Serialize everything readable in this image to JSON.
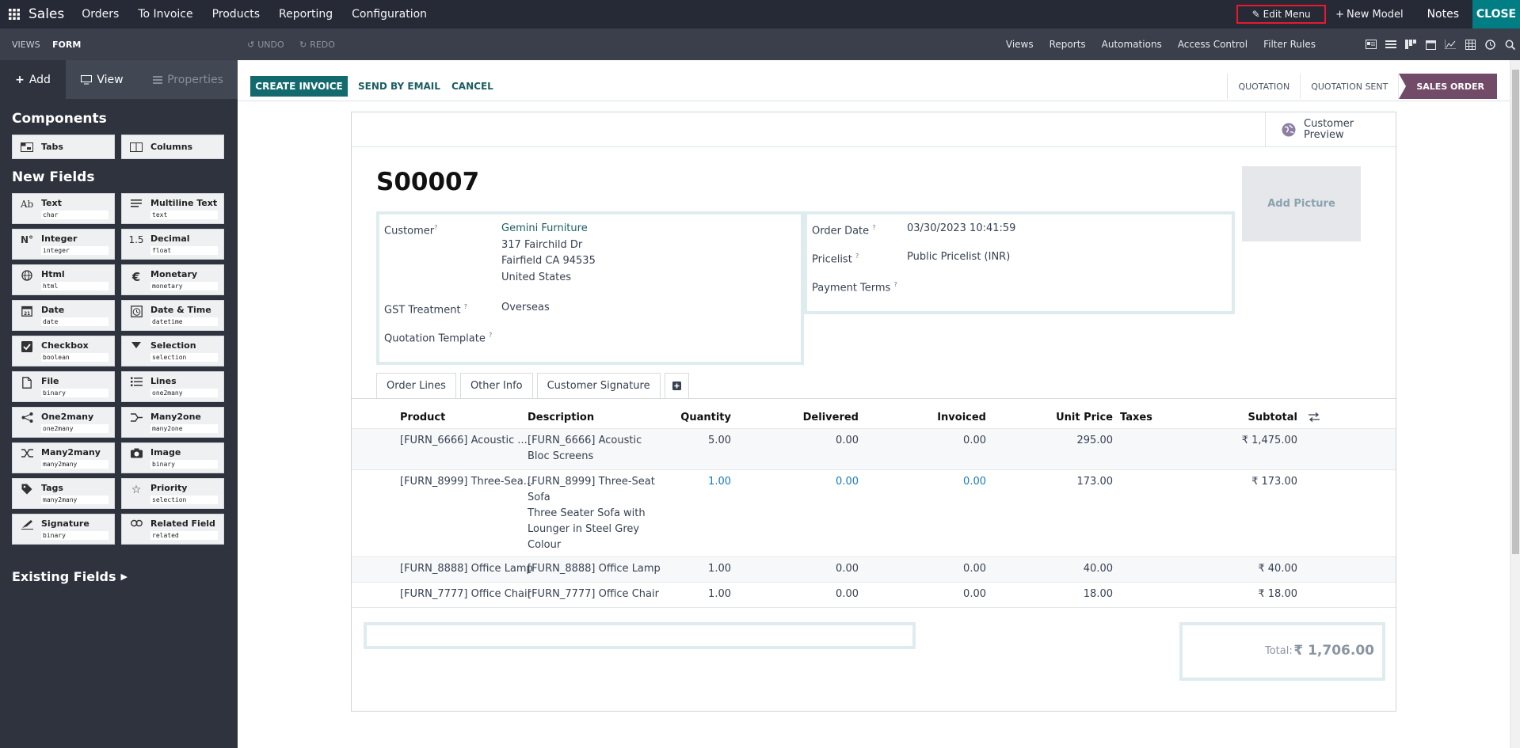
{
  "topbar": {
    "app_name": "Sales",
    "menu": [
      "Orders",
      "To Invoice",
      "Products",
      "Reporting",
      "Configuration"
    ],
    "edit_menu": "Edit Menu",
    "new_model": "New Model",
    "notes": "Notes",
    "close": "CLOSE"
  },
  "subbar": {
    "views": "VIEWS",
    "form": "FORM",
    "undo": "UNDO",
    "redo": "REDO",
    "links": [
      "Views",
      "Reports",
      "Automations",
      "Access Control",
      "Filter Rules"
    ]
  },
  "sidebar": {
    "tabs": {
      "add": "Add",
      "view": "View",
      "properties": "Properties"
    },
    "components_heading": "Components",
    "components": [
      {
        "name": "Tabs",
        "icon": "tabs-icon"
      },
      {
        "name": "Columns",
        "icon": "columns-icon"
      }
    ],
    "new_fields_heading": "New Fields",
    "fields": [
      {
        "name": "Text",
        "type": "char",
        "icon": "Ab"
      },
      {
        "name": "Multiline Text",
        "type": "text",
        "icon": "lines-icon"
      },
      {
        "name": "Integer",
        "type": "integer",
        "icon": "N°"
      },
      {
        "name": "Decimal",
        "type": "float",
        "icon": "1.5"
      },
      {
        "name": "Html",
        "type": "html",
        "icon": "globe-icon"
      },
      {
        "name": "Monetary",
        "type": "monetary",
        "icon": "€"
      },
      {
        "name": "Date",
        "type": "date",
        "icon": "calendar-icon"
      },
      {
        "name": "Date & Time",
        "type": "datetime",
        "icon": "clock-icon"
      },
      {
        "name": "Checkbox",
        "type": "boolean",
        "icon": "checkbox-icon"
      },
      {
        "name": "Selection",
        "type": "selection",
        "icon": "caret-down-icon"
      },
      {
        "name": "File",
        "type": "binary",
        "icon": "file-icon"
      },
      {
        "name": "Lines",
        "type": "one2many",
        "icon": "list-icon"
      },
      {
        "name": "One2many",
        "type": "one2many",
        "icon": "share-icon"
      },
      {
        "name": "Many2one",
        "type": "many2one",
        "icon": "merge-icon"
      },
      {
        "name": "Many2many",
        "type": "many2many",
        "icon": "shuffle-icon"
      },
      {
        "name": "Image",
        "type": "binary",
        "icon": "camera-icon"
      },
      {
        "name": "Tags",
        "type": "many2many",
        "icon": "tag-icon"
      },
      {
        "name": "Priority",
        "type": "selection",
        "icon": "star-icon"
      },
      {
        "name": "Signature",
        "type": "binary",
        "icon": "signature-icon"
      },
      {
        "name": "Related Field",
        "type": "related",
        "icon": "link-icon"
      }
    ],
    "existing_fields": "Existing Fields"
  },
  "control": {
    "create_invoice": "CREATE INVOICE",
    "send_by_email": "SEND BY EMAIL",
    "cancel": "CANCEL",
    "stages": [
      "QUOTATION",
      "QUOTATION SENT",
      "SALES ORDER"
    ],
    "active_stage": "SALES ORDER"
  },
  "form": {
    "customer_preview": [
      "Customer",
      "Preview"
    ],
    "name": "S00007",
    "add_picture": "Add Picture",
    "labels": {
      "customer": "Customer",
      "gst": "GST Treatment",
      "quotation_template": "Quotation Template",
      "order_date": "Order Date",
      "pricelist": "Pricelist",
      "payment_terms": "Payment Terms"
    },
    "values": {
      "customer_name": "Gemini Furniture",
      "address1": "317 Fairchild Dr",
      "address2": "Fairfield CA 94535",
      "address3": "United States",
      "gst": "Overseas",
      "order_date": "03/30/2023 10:41:59",
      "pricelist": "Public Pricelist (INR)"
    },
    "tabs": [
      "Order Lines",
      "Other Info",
      "Customer Signature"
    ],
    "table_headers": {
      "product": "Product",
      "description": "Description",
      "quantity": "Quantity",
      "delivered": "Delivered",
      "invoiced": "Invoiced",
      "unit_price": "Unit Price",
      "taxes": "Taxes",
      "subtotal": "Subtotal"
    },
    "lines": [
      {
        "product": "[FURN_6666] Acoustic ...",
        "description": [
          "[FURN_6666] Acoustic",
          "Bloc Screens"
        ],
        "quantity": "5.00",
        "delivered": "0.00",
        "invoiced": "0.00",
        "unit_price": "295.00",
        "subtotal": "₹ 1,475.00"
      },
      {
        "product": "[FURN_8999] Three-Sea...",
        "description": [
          "[FURN_8999] Three-Seat",
          "Sofa",
          "Three Seater Sofa with",
          "Lounger in Steel Grey",
          "Colour"
        ],
        "quantity": "1.00",
        "delivered": "0.00",
        "invoiced": "0.00",
        "unit_price": "173.00",
        "subtotal": "₹ 173.00"
      },
      {
        "product": "[FURN_8888] Office Lamp",
        "description": [
          "[FURN_8888] Office Lamp"
        ],
        "quantity": "1.00",
        "delivered": "0.00",
        "invoiced": "0.00",
        "unit_price": "40.00",
        "subtotal": "₹ 40.00"
      },
      {
        "product": "[FURN_7777] Office Chair",
        "description": [
          "[FURN_7777] Office Chair"
        ],
        "quantity": "1.00",
        "delivered": "0.00",
        "invoiced": "0.00",
        "unit_price": "18.00",
        "subtotal": "₹ 18.00"
      }
    ],
    "total_label": "Total:",
    "total_value": "₹ 1,706.00"
  },
  "colors": {
    "navbar": "#262a36",
    "sidebar": "#2e333d",
    "primary": "#136a6e",
    "active_stage": "#714b67",
    "close": "#017e84",
    "highlight_border": "#e8192c"
  }
}
